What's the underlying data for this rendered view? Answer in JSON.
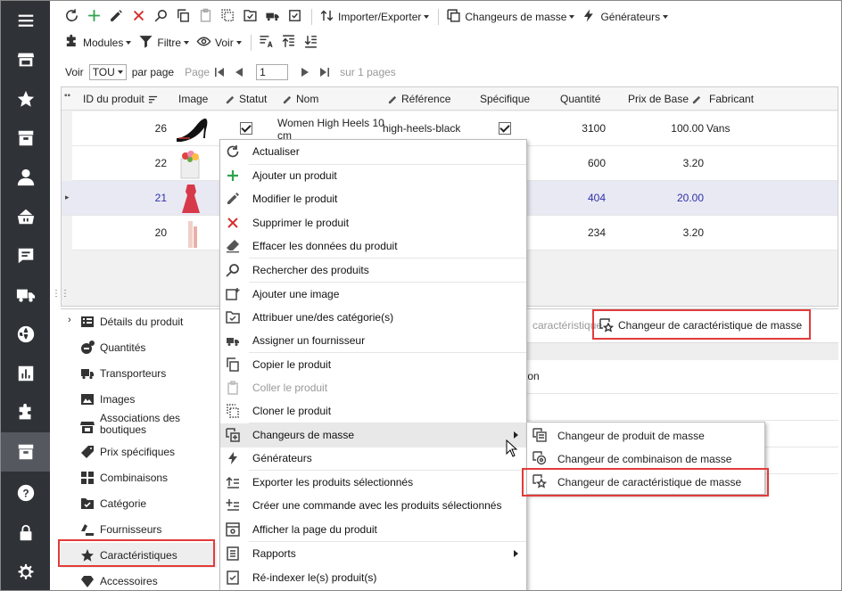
{
  "toolbar1": {
    "refresh_icon": "refresh-icon",
    "import_export": "Importer/Exporter",
    "mass_changers": "Changeurs de masse",
    "generators": "Générateurs"
  },
  "toolbar2": {
    "modules": "Modules",
    "filter": "Filtre",
    "view": "Voir"
  },
  "pager": {
    "show": "Voir",
    "all": "TOU",
    "per_page": "par page",
    "page": "Page",
    "page_value": "1",
    "of_pages": "sur 1 pages"
  },
  "grid": {
    "columns": [
      "ID du produit",
      "Image",
      "Statut",
      "Nom",
      "Référence",
      "Spécifique",
      "Quantité",
      "Prix de Base",
      "Fabricant"
    ],
    "rows": [
      {
        "id": "26",
        "name": "Women High Heels 10",
        "name2": "cm",
        "reference": "high-heels-black",
        "quantity": "3100",
        "price": "100.00",
        "manufacturer": "Vans"
      },
      {
        "id": "22",
        "name": "",
        "name2": "",
        "reference": "",
        "quantity": "600",
        "price": "3.20",
        "manufacturer": ""
      },
      {
        "id": "21",
        "name": "",
        "name2": "",
        "reference": "",
        "quantity": "404",
        "price": "20.00",
        "manufacturer": ""
      },
      {
        "id": "20",
        "name": "",
        "name2": "",
        "reference": "",
        "quantity": "234",
        "price": "3.20",
        "manufacturer": ""
      }
    ]
  },
  "details": {
    "items": [
      "Détails du produit",
      "Quantités",
      "Transporteurs",
      "Images",
      "Associations des",
      "boutiques",
      "Prix spécifiques",
      "Combinaisons",
      "Catégorie",
      "Fournisseurs",
      "Caractéristiques",
      "Accessoires"
    ]
  },
  "features_panel": {
    "tab_partial": "caractéristique",
    "mass_button": "Changeur de caractéristique de masse",
    "cell_partial": "ton"
  },
  "context_menu": {
    "items": [
      "Actualiser",
      "Ajouter un produit",
      "Modifier le produit",
      "Supprimer le produit",
      "Effacer les données du produit",
      "Rechercher des produits",
      "Ajouter une image",
      "Attribuer une/des catégorie(s)",
      "Assigner un fournisseur",
      "Copier le produit",
      "Coller le produit",
      "Cloner le produit",
      "Changeurs de masse",
      "Générateurs",
      "Exporter les produits sélectionnés",
      "Créer une commande avec les produits sélectionnés",
      "Afficher la page du produit",
      "Rapports",
      "Ré-indexer le(s) produit(s)"
    ]
  },
  "submenu": {
    "items": [
      "Changeur de produit de masse",
      "Changeur de combinaison de masse",
      "Changeur de caractéristique de masse"
    ]
  },
  "colors": {
    "sidebar": "#2f3237",
    "accent_red": "#e23b3b",
    "add_green": "#2da44e",
    "delete_red": "#d32f2f",
    "selected_row_text": "#3030a8"
  }
}
